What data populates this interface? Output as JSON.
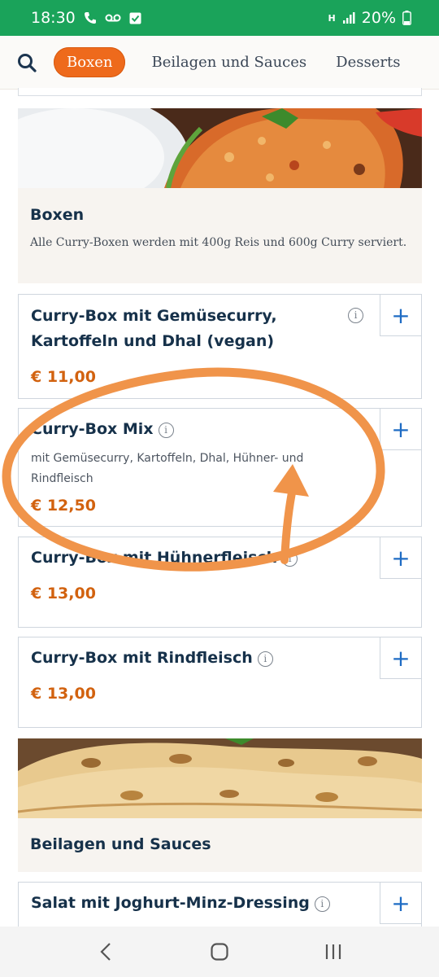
{
  "status_bar": {
    "time": "18:30",
    "battery": "20%",
    "signal_label": "H"
  },
  "nav": {
    "tabs": [
      {
        "label": "Boxen",
        "active": true
      },
      {
        "label": "Beilagen und Sauces",
        "active": false
      },
      {
        "label": "Desserts",
        "active": false
      }
    ]
  },
  "categories": {
    "boxen": {
      "title": "Boxen",
      "description": "Alle Curry-Boxen werden mit 400g Reis und 600g Curry serviert."
    },
    "beilagen": {
      "title": "Beilagen und Sauces"
    }
  },
  "items": [
    {
      "name": "Curry-Box mit Gemüsecurry, Kartoffeln und Dhal (vegan)",
      "price": "€ 11,00",
      "description": ""
    },
    {
      "name": "Curry-Box Mix",
      "price": "€ 12,50",
      "description": "mit Gemüsecurry, Kartoffeln, Dhal, Hühner- und Rindfleisch"
    },
    {
      "name": "Curry-Box mit Hühnerfleisch",
      "price": "€ 13,00",
      "description": ""
    },
    {
      "name": "Curry-Box mit Rindfleisch",
      "price": "€ 13,00",
      "description": ""
    },
    {
      "name": "Salat mit Joghurt-Minz-Dressing",
      "price": "",
      "description": ""
    }
  ],
  "add_label": "+",
  "info_glyph": "i",
  "colors": {
    "accent": "#ee6a1c",
    "price": "#d2620f",
    "plus": "#1f6cc4",
    "status_bar": "#1aa35a",
    "annotation": "#f0944a"
  }
}
